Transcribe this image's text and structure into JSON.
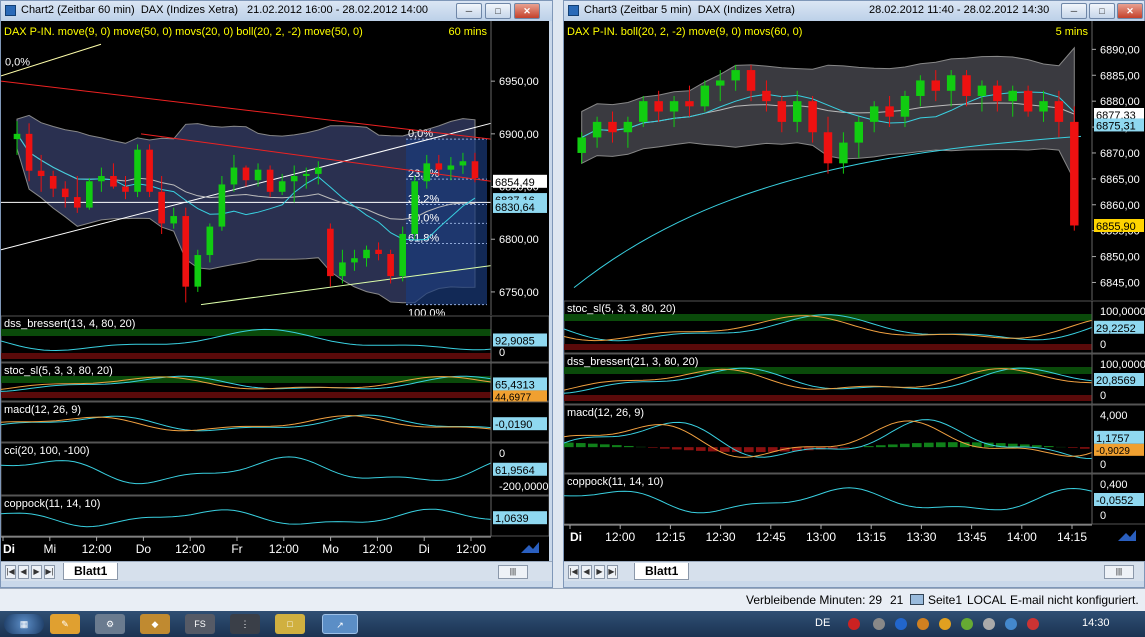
{
  "left_window": {
    "title": "Chart2 (Zeitbar 60 min)",
    "subtitle": "DAX (Indizes Xetra)",
    "range": "21.02.2012 16:00 - 28.02.2012 14:00",
    "sheet_tab": "Blatt1"
  },
  "right_window": {
    "title": "Chart3 (Zeitbar 5 min)",
    "subtitle": "DAX (Indizes Xetra)",
    "range": "28.02.2012 11:40 - 28.02.2012 14:30",
    "sheet_tab": "Blatt1"
  },
  "status_bar": {
    "remaining_label": "Verbleibende Minuten: 29",
    "count": "21",
    "page": "Seite1",
    "mode": "LOCAL",
    "email": "E-mail nicht konfiguriert."
  },
  "taskbar": {
    "language": "DE",
    "clock": "14:30",
    "app_fs": "FS"
  },
  "colors": {
    "up": "#11cc11",
    "down": "#ee1111",
    "band_fill": "#3a3a40",
    "cyan": "#39d0e0",
    "orange": "#f0a040",
    "indicator_label": "#ffffff",
    "chart_label": "#ffff00"
  },
  "chart_data": [
    {
      "type": "candlestick",
      "title": "DAX P-IN. move(9, 0) move(50, 0) movs(20, 0) boll(20, 2, -2) move(50, 0)",
      "interval_label": "60 mins",
      "ylim": [
        6730,
        6990
      ],
      "y_ticks": [
        "6950,00",
        "6900,00",
        "6850,00",
        "6800,00",
        "6750,00"
      ],
      "y_tick_values": [
        6950,
        6900,
        6850,
        6800,
        6750
      ],
      "x_ticks": [
        "Di",
        "Mi",
        "12:00",
        "Do",
        "12:00",
        "Fr",
        "12:00",
        "Mo",
        "12:00",
        "Di",
        "12:00"
      ],
      "price_labels": [
        "6854,49",
        "6837,16",
        "6830,64"
      ],
      "price_label_values": [
        6854.49,
        6837.16,
        6830.64
      ],
      "fib_levels": [
        "0,0%",
        "23,6%",
        "38,2%",
        "50,0%",
        "61,8%",
        "100,0%"
      ],
      "fib_values": [
        6895,
        6857,
        6833,
        6815,
        6796,
        6738
      ],
      "top_fib_label": "0,0%",
      "candles": [
        [
          6895,
          6912,
          6880,
          6900
        ],
        [
          6900,
          6910,
          6855,
          6865
        ],
        [
          6865,
          6880,
          6845,
          6860
        ],
        [
          6860,
          6865,
          6840,
          6848
        ],
        [
          6848,
          6855,
          6830,
          6840
        ],
        [
          6840,
          6860,
          6825,
          6830
        ],
        [
          6830,
          6858,
          6828,
          6855
        ],
        [
          6855,
          6868,
          6845,
          6860
        ],
        [
          6860,
          6872,
          6848,
          6850
        ],
        [
          6850,
          6860,
          6838,
          6845
        ],
        [
          6845,
          6890,
          6840,
          6885
        ],
        [
          6885,
          6890,
          6840,
          6845
        ],
        [
          6845,
          6860,
          6805,
          6815
        ],
        [
          6815,
          6830,
          6810,
          6822
        ],
        [
          6822,
          6830,
          6740,
          6755
        ],
        [
          6755,
          6790,
          6750,
          6785
        ],
        [
          6785,
          6815,
          6778,
          6812
        ],
        [
          6812,
          6860,
          6808,
          6852
        ],
        [
          6852,
          6880,
          6845,
          6868
        ],
        [
          6868,
          6870,
          6850,
          6856
        ],
        [
          6856,
          6872,
          6850,
          6866
        ],
        [
          6866,
          6870,
          6840,
          6845
        ],
        [
          6845,
          6862,
          6842,
          6855
        ],
        [
          6855,
          6870,
          6835,
          6860
        ],
        [
          6860,
          6868,
          6848,
          6862
        ],
        [
          6862,
          6874,
          6852,
          6868
        ],
        [
          6810,
          6815,
          6755,
          6765
        ],
        [
          6765,
          6790,
          6758,
          6778
        ],
        [
          6778,
          6790,
          6770,
          6782
        ],
        [
          6782,
          6794,
          6774,
          6790
        ],
        [
          6790,
          6797,
          6780,
          6786
        ],
        [
          6786,
          6790,
          6758,
          6765
        ],
        [
          6765,
          6812,
          6760,
          6805
        ],
        [
          6805,
          6860,
          6800,
          6855
        ],
        [
          6855,
          6880,
          6848,
          6872
        ],
        [
          6872,
          6880,
          6860,
          6866
        ],
        [
          6866,
          6878,
          6856,
          6870
        ],
        [
          6870,
          6882,
          6862,
          6874
        ],
        [
          6874,
          6882,
          6854,
          6858
        ]
      ],
      "indicators": [
        {
          "name": "dss_bressert(13, 4, 80, 20)",
          "value": "92,9085",
          "ticks": [
            "0"
          ]
        },
        {
          "name": "stoc_sl(5, 3, 3, 80, 20)",
          "value": "65,4313",
          "value2": "44,6977",
          "ticks": []
        },
        {
          "name": "macd(12, 26, 9)",
          "value": "-0,0190",
          "ticks": []
        },
        {
          "name": "cci(20, 100, -100)",
          "value": "61,9564",
          "ticks": [
            "0",
            "-200,0000"
          ]
        },
        {
          "name": "coppock(11, 14, 10)",
          "value": "1,0639",
          "ticks": []
        }
      ]
    },
    {
      "type": "candlestick",
      "title": "DAX P-IN. boll(20, 2, -2) move(9, 0) movs(60, 0)",
      "interval_label": "5 mins",
      "ylim": [
        6842,
        6892
      ],
      "y_ticks": [
        "6890,00",
        "6885,00",
        "6880,00",
        "6875,00",
        "6870,00",
        "6865,00",
        "6860,00",
        "6855,00",
        "6850,00",
        "6845,00"
      ],
      "y_tick_values": [
        6890,
        6885,
        6880,
        6875,
        6870,
        6865,
        6860,
        6855,
        6850,
        6845
      ],
      "x_ticks": [
        "Di",
        "12:00",
        "12:15",
        "12:30",
        "12:45",
        "13:00",
        "13:15",
        "13:30",
        "13:45",
        "14:00",
        "14:15"
      ],
      "price_labels": [
        "6877,33",
        "6875,31",
        "6855,90"
      ],
      "price_label_values": [
        6877.33,
        6875.31,
        6855.9
      ],
      "candles": [
        [
          6870,
          6874,
          6868,
          6873
        ],
        [
          6873,
          6877,
          6871,
          6876
        ],
        [
          6876,
          6878,
          6872,
          6874
        ],
        [
          6874,
          6877,
          6871,
          6876
        ],
        [
          6876,
          6881,
          6875,
          6880
        ],
        [
          6880,
          6882,
          6876,
          6878
        ],
        [
          6878,
          6881,
          6875,
          6880
        ],
        [
          6880,
          6883,
          6877,
          6879
        ],
        [
          6879,
          6884,
          6878,
          6883
        ],
        [
          6883,
          6886,
          6880,
          6884
        ],
        [
          6884,
          6887,
          6882,
          6886
        ],
        [
          6886,
          6887,
          6880,
          6882
        ],
        [
          6882,
          6884,
          6878,
          6880
        ],
        [
          6880,
          6881,
          6874,
          6876
        ],
        [
          6876,
          6882,
          6874,
          6880
        ],
        [
          6880,
          6881,
          6872,
          6874
        ],
        [
          6874,
          6877,
          6866,
          6868
        ],
        [
          6868,
          6874,
          6866,
          6872
        ],
        [
          6872,
          6877,
          6869,
          6876
        ],
        [
          6876,
          6880,
          6874,
          6879
        ],
        [
          6879,
          6881,
          6875,
          6877
        ],
        [
          6877,
          6882,
          6875,
          6881
        ],
        [
          6881,
          6885,
          6879,
          6884
        ],
        [
          6884,
          6886,
          6880,
          6882
        ],
        [
          6882,
          6886,
          6879,
          6885
        ],
        [
          6885,
          6886,
          6879,
          6881
        ],
        [
          6881,
          6884,
          6878,
          6883
        ],
        [
          6883,
          6884,
          6878,
          6880
        ],
        [
          6880,
          6883,
          6877,
          6882
        ],
        [
          6882,
          6883,
          6877,
          6878
        ],
        [
          6878,
          6882,
          6876,
          6880
        ],
        [
          6880,
          6882,
          6873,
          6876
        ],
        [
          6876,
          6879,
          6855,
          6856
        ]
      ],
      "indicators": [
        {
          "name": "stoc_sl(5, 3, 3, 80, 20)",
          "value": "29,2252",
          "ticks": [
            "100,0000",
            "0"
          ]
        },
        {
          "name": "dss_bressert(21, 3, 80, 20)",
          "value": "20,8569",
          "ticks": [
            "100,0000",
            "0"
          ]
        },
        {
          "name": "macd(12, 26, 9)",
          "value": "1,1757",
          "value2": "-0,9029",
          "ticks": [
            "4,000",
            "0"
          ]
        },
        {
          "name": "coppock(11, 14, 10)",
          "value": "-0,0552",
          "ticks": [
            "0,400",
            "0"
          ]
        }
      ]
    }
  ]
}
